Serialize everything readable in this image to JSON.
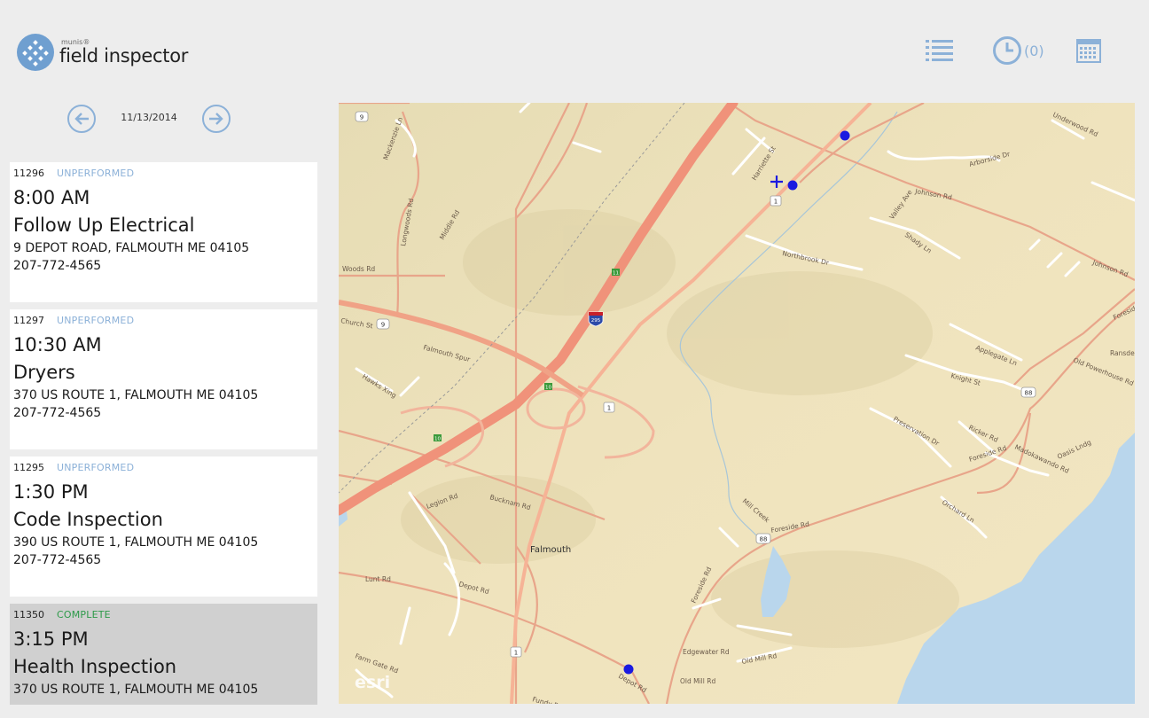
{
  "app": {
    "brand": "munis®",
    "product": "field inspector"
  },
  "toolbar": {
    "history_count": "(0)"
  },
  "date_nav": {
    "date": "11/13/2014"
  },
  "inspections": [
    {
      "id": "11296",
      "status": "UNPERFORMED",
      "time": "8:00 AM",
      "title": "Follow Up Electrical",
      "address": "9 DEPOT ROAD, FALMOUTH ME 04105",
      "phone": "207-772-4565"
    },
    {
      "id": "11297",
      "status": "UNPERFORMED",
      "time": "10:30 AM",
      "title": "Dryers",
      "address": "370 US ROUTE 1, FALMOUTH ME 04105",
      "phone": "207-772-4565"
    },
    {
      "id": "11295",
      "status": "UNPERFORMED",
      "time": "1:30 PM",
      "title": "Code Inspection",
      "address": "390 US ROUTE 1, FALMOUTH ME 04105",
      "phone": "207-772-4565"
    },
    {
      "id": "11350",
      "status": "COMPLETE",
      "time": "3:15 PM",
      "title": "Health Inspection",
      "address": "370 US ROUTE 1, FALMOUTH ME 04105",
      "phone": ""
    }
  ],
  "map": {
    "town_label": "Falmouth",
    "watermark": "esri",
    "road_labels": {
      "johnson_rd": "Johnson Rd",
      "johnson_rd_2": "Johnson Rd",
      "northbrook": "Northbrook Dr",
      "foreside_rd": "Foreside Rd",
      "foreside_rd_2": "Foreside Rd",
      "foreside_rd_3": "Foreside Rd",
      "depot_rd": "Depot Rd",
      "bucknam_rd": "Bucknam Rd",
      "falmouth_spur": "Falmouth Spur",
      "middle_rd": "Middle Rd",
      "longwoods_rd": "Longwoods Rd",
      "woods_rd": "Woods Rd",
      "hawks_xing": "Hawks Xing",
      "lunt_rd": "Lunt Rd",
      "applegate_ln": "Applegate Ln",
      "knight_st": "Knight St",
      "preservation_dr": "Preservation Dr",
      "ricker_rd": "Ricker Rd",
      "madokawando_rd": "Madokawando Rd",
      "orchard_ln": "Orchard Ln",
      "edgewater_rd": "Edgewater Rd",
      "old_mill_rd": "Old Mill Rd",
      "mill_creek": "Mill Creek",
      "shady_ln": "Shady Ln",
      "valley_ave": "Valley Ave",
      "arborside_dr": "Arborside Dr",
      "underwood_rd": "Underwood Rd",
      "old_powerhouse_rd": "Old Powerhouse Rd",
      "legion_rd": "Legion Rd",
      "farm_gate_rd": "Farm Gate Rd",
      "fundy_rd": "Fundy Rd",
      "mackenzie_ln": "Mackenzie Ln",
      "harriette_st": "Harriette St",
      "church_st": "Church St",
      "oasis_lndg": "Oasis Lndg",
      "ransdell": "Ransdell"
    },
    "shields": {
      "rt9a": "9",
      "rt9b": "9",
      "rt1a": "1",
      "rt1b": "1",
      "rt1c": "1",
      "rt88a": "88",
      "rt88b": "88",
      "i295": "295",
      "exit11": "11",
      "exit10": "10",
      "exit10b": "10"
    },
    "marker_color": "#1a1ae0"
  },
  "colors": {
    "accent": "#8cb1d8",
    "complete": "#2e9a4a",
    "selected_bg": "#d0d0d0"
  }
}
